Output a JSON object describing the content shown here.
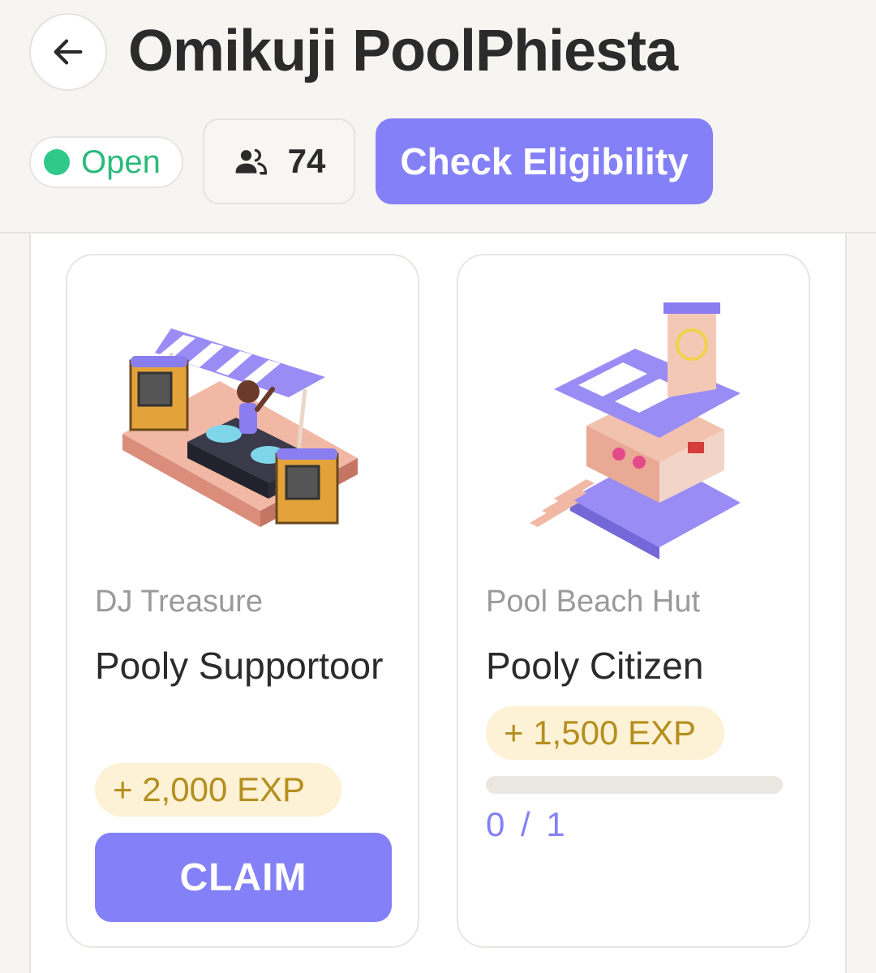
{
  "header": {
    "title": "Omikuji PoolPhiesta",
    "back_icon": "arrow-left-icon",
    "status": {
      "label": "Open",
      "color": "#2fc989"
    },
    "participants": {
      "icon": "users-icon",
      "count": "74"
    },
    "check_button": {
      "label": "Check Eligibility",
      "color": "#8480f7"
    }
  },
  "cards": [
    {
      "image": "dj-treasure-pixel-art",
      "category": "DJ Treasure",
      "title": "Pooly Supportoor",
      "exp": "+ 2,000 EXP",
      "action_label": "CLAIM"
    },
    {
      "image": "pool-beach-hut-pixel-art",
      "category": "Pool Beach Hut",
      "title": "Pooly Citizen",
      "exp": "+ 1,500 EXP",
      "progress": {
        "current": 0,
        "total": 1,
        "label": "0 / 1"
      }
    }
  ]
}
